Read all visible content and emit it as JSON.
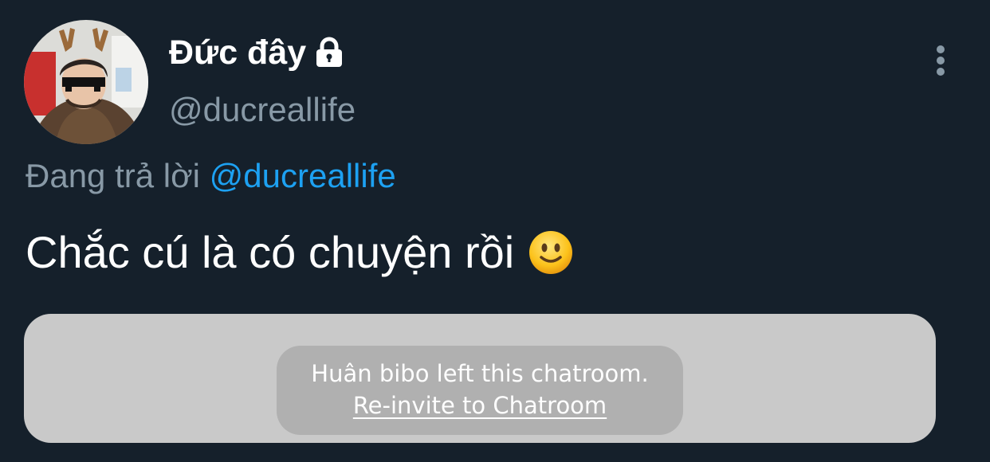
{
  "tweet": {
    "display_name": "Đức đây",
    "handle": "@ducreallife",
    "protected_icon": "lock-icon",
    "more_icon": "more-vertical-icon",
    "reply_prefix": "Đang trả lời",
    "reply_mention": "@ducreallife",
    "text": "Chắc cú là có chuyện rồi",
    "emoji": "slightly-smiling-face-icon"
  },
  "chat_notice": {
    "message": "Huân bibo left this chatroom.",
    "action_label": "Re-invite to Chatroom"
  },
  "colors": {
    "background": "#15202b",
    "primary_text": "#ffffff",
    "secondary_text": "#8899a6",
    "mention": "#1da1f2",
    "card": "#c9c9c9",
    "notice": "#b0b0b0"
  }
}
